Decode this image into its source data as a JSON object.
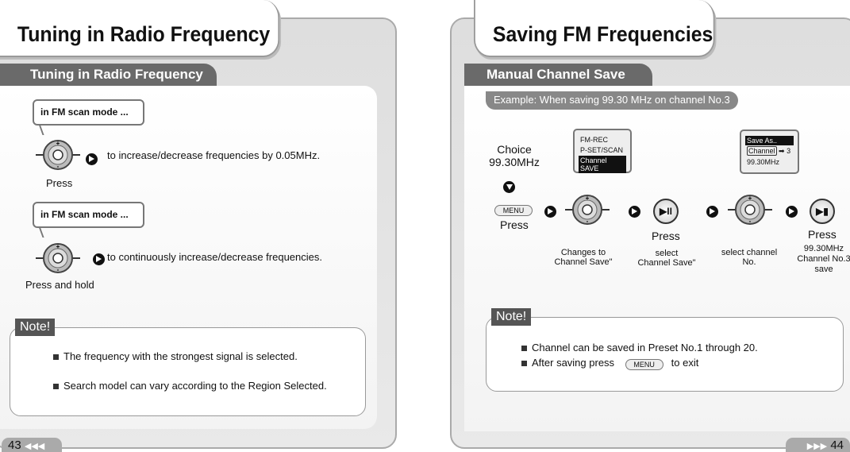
{
  "left": {
    "title": "Tuning in Radio Frequency",
    "subtitle": "Tuning in Radio Frequency",
    "step1": {
      "bubble": "in FM scan mode ...",
      "text": "to increase/decrease frequencies by 0.05MHz.",
      "action": "Press"
    },
    "step2": {
      "bubble": "in FM scan mode ...",
      "text": "to continuously increase/decrease frequencies.",
      "action": "Press and hold"
    },
    "note": {
      "label": "Note!",
      "items": [
        "The frequency with the strongest signal is selected.",
        "Search model can vary according to the Region Selected."
      ]
    },
    "page_number": "43"
  },
  "right": {
    "title": "Saving FM Frequencies",
    "subtitle": "Manual Channel Save",
    "example": "Example: When saving 99.30 MHz on channel No.3",
    "choice": "Choice",
    "choice_freq": "99.30MHz",
    "menu_button": "MENU",
    "press": "Press",
    "lcd1": [
      "FM-REC",
      "P-SET/SCAN",
      "Channel SAVE"
    ],
    "lcd2": {
      "line1": "Save As..",
      "channel": "Channel",
      "number": "3",
      "freq": "99.30MHz"
    },
    "captions": {
      "changes_to": "Changes to",
      "channel_save1": "Channel Save\"",
      "select": "select",
      "channel_save2": "Channel Save\"",
      "select_channel": "select channel",
      "no": "No.",
      "freq": "99.30MHz",
      "channel_no": "Channel No.3",
      "save": "save"
    },
    "note": {
      "label": "Note!",
      "item1": "Channel can be saved in Preset No.1 through 20.",
      "item2_pre": "After saving press",
      "item2_btn": "MENU",
      "item2_post": "to exit"
    },
    "page_number": "44"
  }
}
